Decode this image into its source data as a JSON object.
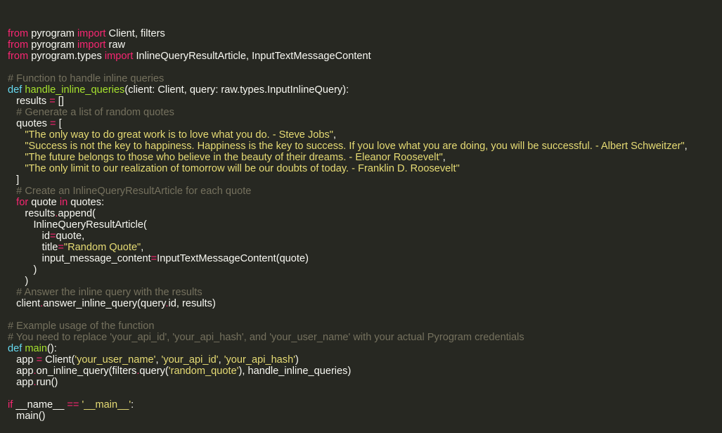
{
  "colors": {
    "background": "#272822",
    "text": "#f8f8f2",
    "keyword": "#f92672",
    "definition": "#66d9ef",
    "function_name": "#a6e22e",
    "string": "#e6db74",
    "comment": "#75715e"
  },
  "code": {
    "lines": [
      [
        [
          "kw",
          "from"
        ],
        [
          "txt",
          " pyrogram "
        ],
        [
          "kw",
          "import"
        ],
        [
          "txt",
          " Client, filters"
        ]
      ],
      [
        [
          "kw",
          "from"
        ],
        [
          "txt",
          " pyrogram "
        ],
        [
          "kw",
          "import"
        ],
        [
          "txt",
          " raw"
        ]
      ],
      [
        [
          "kw",
          "from"
        ],
        [
          "txt",
          " pyrogram.types "
        ],
        [
          "kw",
          "import"
        ],
        [
          "txt",
          " InlineQueryResultArticle, InputTextMessageContent"
        ]
      ],
      [],
      [
        [
          "cmt",
          "# Function to handle inline queries"
        ]
      ],
      [
        [
          "def",
          "def"
        ],
        [
          "txt",
          " "
        ],
        [
          "fn",
          "handle_inline_queries"
        ],
        [
          "txt",
          "(client: Client, query: raw.types.InputInlineQuery):"
        ]
      ],
      [
        [
          "txt",
          "   results "
        ],
        [
          "op",
          "="
        ],
        [
          "txt",
          " []"
        ]
      ],
      [
        [
          "cmt",
          "   # Generate a list of random quotes"
        ]
      ],
      [
        [
          "txt",
          "   quotes "
        ],
        [
          "op",
          "="
        ],
        [
          "txt",
          " ["
        ]
      ],
      [
        [
          "txt",
          "      "
        ],
        [
          "str",
          "\"The only way to do great work is to love what you do. - Steve Jobs\""
        ],
        [
          "txt",
          ","
        ]
      ],
      [
        [
          "txt",
          "      "
        ],
        [
          "str",
          "\"Success is not the key to happiness. Happiness is the key to success. If you love what you are doing, you will be successful. - Albert Schweitzer\""
        ],
        [
          "txt",
          ","
        ]
      ],
      [
        [
          "txt",
          "      "
        ],
        [
          "str",
          "\"The future belongs to those who believe in the beauty of their dreams. - Eleanor Roosevelt\""
        ],
        [
          "txt",
          ","
        ]
      ],
      [
        [
          "txt",
          "      "
        ],
        [
          "str",
          "\"The only limit to our realization of tomorrow will be our doubts of today. - Franklin D. Roosevelt\""
        ]
      ],
      [
        [
          "txt",
          "   ]"
        ]
      ],
      [
        [
          "cmt",
          "   # Create an InlineQueryResultArticle for each quote"
        ]
      ],
      [
        [
          "txt",
          "   "
        ],
        [
          "kw",
          "for"
        ],
        [
          "txt",
          " quote "
        ],
        [
          "kw",
          "in"
        ],
        [
          "txt",
          " quotes:"
        ]
      ],
      [
        [
          "txt",
          "      results"
        ],
        [
          "op",
          "."
        ],
        [
          "txt",
          "append("
        ]
      ],
      [
        [
          "txt",
          "         InlineQueryResultArticle("
        ]
      ],
      [
        [
          "txt",
          "            id"
        ],
        [
          "op",
          "="
        ],
        [
          "txt",
          "quote,"
        ]
      ],
      [
        [
          "txt",
          "            title"
        ],
        [
          "op",
          "="
        ],
        [
          "str",
          "\"Random Quote\""
        ],
        [
          "txt",
          ","
        ]
      ],
      [
        [
          "txt",
          "            input_message_content"
        ],
        [
          "op",
          "="
        ],
        [
          "txt",
          "InputTextMessageContent(quote)"
        ]
      ],
      [
        [
          "txt",
          "         )"
        ]
      ],
      [
        [
          "txt",
          "      )"
        ]
      ],
      [
        [
          "cmt",
          "   # Answer the inline query with the results"
        ]
      ],
      [
        [
          "txt",
          "   client"
        ],
        [
          "op",
          "."
        ],
        [
          "txt",
          "answer_inline_query(query"
        ],
        [
          "op",
          "."
        ],
        [
          "txt",
          "id, results)"
        ]
      ],
      [],
      [
        [
          "cmt",
          "# Example usage of the function"
        ]
      ],
      [
        [
          "cmt",
          "# You need to replace 'your_api_id', 'your_api_hash', and 'your_user_name' with your actual Pyrogram credentials"
        ]
      ],
      [
        [
          "def",
          "def"
        ],
        [
          "txt",
          " "
        ],
        [
          "fn",
          "main"
        ],
        [
          "txt",
          "():"
        ]
      ],
      [
        [
          "txt",
          "   app "
        ],
        [
          "op",
          "="
        ],
        [
          "txt",
          " Client("
        ],
        [
          "str",
          "'your_user_name'"
        ],
        [
          "txt",
          ", "
        ],
        [
          "str",
          "'your_api_id'"
        ],
        [
          "txt",
          ", "
        ],
        [
          "str",
          "'your_api_hash'"
        ],
        [
          "txt",
          ")"
        ]
      ],
      [
        [
          "txt",
          "   app"
        ],
        [
          "op",
          "."
        ],
        [
          "txt",
          "on_inline_query(filters"
        ],
        [
          "op",
          "."
        ],
        [
          "txt",
          "query("
        ],
        [
          "str",
          "'random_quote'"
        ],
        [
          "txt",
          "), handle_inline_queries)"
        ]
      ],
      [
        [
          "txt",
          "   app"
        ],
        [
          "op",
          "."
        ],
        [
          "txt",
          "run()"
        ]
      ],
      [],
      [
        [
          "kw",
          "if"
        ],
        [
          "txt",
          " __name__ "
        ],
        [
          "op",
          "=="
        ],
        [
          "txt",
          " "
        ],
        [
          "str",
          "'__main__'"
        ],
        [
          "txt",
          ":"
        ]
      ],
      [
        [
          "txt",
          "   main()"
        ]
      ]
    ]
  }
}
